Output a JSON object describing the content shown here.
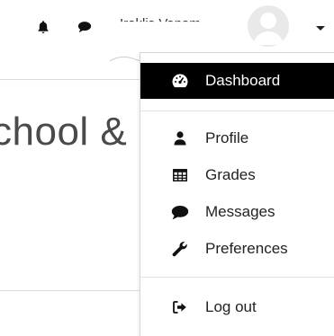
{
  "header": {
    "user_name": "Iraklis Vanam"
  },
  "page": {
    "title_fragment": "chool &"
  },
  "menu": {
    "items": [
      {
        "label": "Dashboard",
        "icon": "tachometer-icon",
        "active": true
      },
      {
        "label": "Profile",
        "icon": "user-icon",
        "active": false
      },
      {
        "label": "Grades",
        "icon": "table-icon",
        "active": false
      },
      {
        "label": "Messages",
        "icon": "comment-icon",
        "active": false
      },
      {
        "label": "Preferences",
        "icon": "wrench-icon",
        "active": false
      },
      {
        "label": "Log out",
        "icon": "sign-out-icon",
        "active": false
      }
    ]
  },
  "colors": {
    "active_bg": "#000000",
    "text": "#222222"
  }
}
